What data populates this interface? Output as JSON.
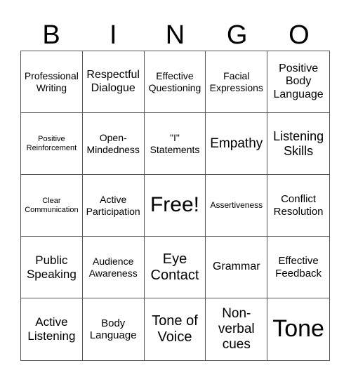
{
  "header": {
    "letters": [
      "B",
      "I",
      "N",
      "G",
      "O"
    ]
  },
  "cells": [
    {
      "text": "Professional Writing",
      "size": 14
    },
    {
      "text": "Respectful Dialogue",
      "size": 16
    },
    {
      "text": "Effective Questioning",
      "size": 14
    },
    {
      "text": "Facial Expressions",
      "size": 14
    },
    {
      "text": "Positive Body Language",
      "size": 16
    },
    {
      "text": "Positive Reinforcement",
      "size": 11
    },
    {
      "text": "Open-Mindedness",
      "size": 14
    },
    {
      "text": "\"I\" Statements",
      "size": 14
    },
    {
      "text": "Empathy",
      "size": 19
    },
    {
      "text": "Listening Skills",
      "size": 18
    },
    {
      "text": "Clear Communication",
      "size": 11
    },
    {
      "text": "Active Participation",
      "size": 14
    },
    {
      "text": "Free!",
      "size": 30
    },
    {
      "text": "Assertiveness",
      "size": 12
    },
    {
      "text": "Conflict Resolution",
      "size": 15
    },
    {
      "text": "Public Speaking",
      "size": 17
    },
    {
      "text": "Audience Awareness",
      "size": 14
    },
    {
      "text": "Eye Contact",
      "size": 20
    },
    {
      "text": "Grammar",
      "size": 16
    },
    {
      "text": "Effective Feedback",
      "size": 15
    },
    {
      "text": "Active Listening",
      "size": 17
    },
    {
      "text": "Body Language",
      "size": 15
    },
    {
      "text": "Tone of Voice",
      "size": 20
    },
    {
      "text": "Non-verbal cues",
      "size": 19
    },
    {
      "text": "Tone",
      "size": 34
    }
  ]
}
